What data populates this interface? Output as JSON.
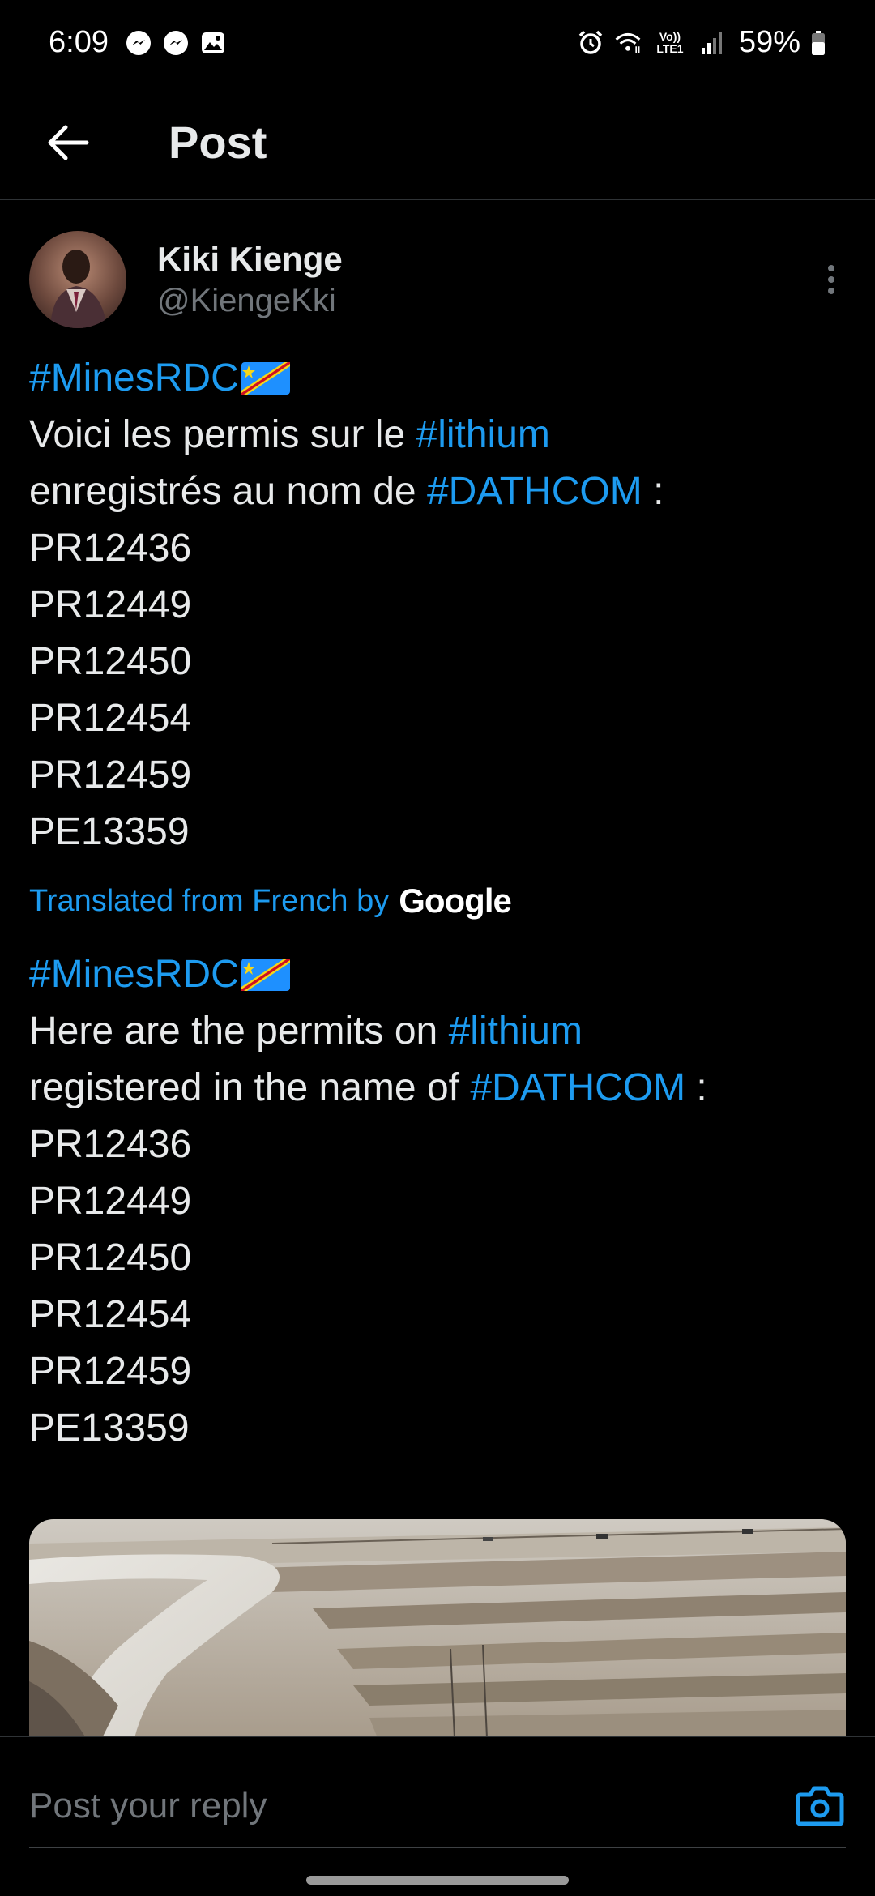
{
  "status_bar": {
    "time": "6:09",
    "left_icons": [
      "messenger-icon",
      "messenger-icon",
      "gallery-icon"
    ],
    "right_icons": [
      "alarm-icon",
      "wifi-icon",
      "volte-icon",
      "signal-icon",
      "battery-icon"
    ],
    "volte_label_top": "Vo))",
    "volte_label_bottom": "LTE1",
    "battery": "59%"
  },
  "header": {
    "title": "Post"
  },
  "post": {
    "author": {
      "display_name": "Kiki Kienge",
      "handle": "@KiengeKki"
    },
    "original": {
      "hashtag_topic": "#MinesRDC",
      "line2_prefix": "Voici les permis sur le ",
      "hashtag_mineral": "#lithium",
      "line3_prefix": "enregistrés au nom de ",
      "hashtag_company": "#DATHCOM",
      "line3_suffix": " :",
      "permits": [
        "PR12436",
        "PR12449",
        "PR12450",
        "PR12454",
        "PR12459",
        "PE13359"
      ]
    },
    "translation_note": {
      "label": "Translated from French by",
      "provider": "Google"
    },
    "translated": {
      "hashtag_topic": "#MinesRDC",
      "line2_prefix": "Here are the permits on ",
      "hashtag_mineral": "#lithium",
      "line3_prefix": "registered in the name of ",
      "hashtag_company": "#DATHCOM",
      "line3_suffix": " :",
      "permits": [
        "PR12436",
        "PR12449",
        "PR12450",
        "PR12454",
        "PR12459",
        "PE13359"
      ]
    }
  },
  "reply": {
    "placeholder": "Post your reply"
  },
  "colors": {
    "background": "#000000",
    "text": "#e7e9ea",
    "secondary_text": "#71767b",
    "accent": "#1d9bf0",
    "divider": "#2f3336"
  }
}
